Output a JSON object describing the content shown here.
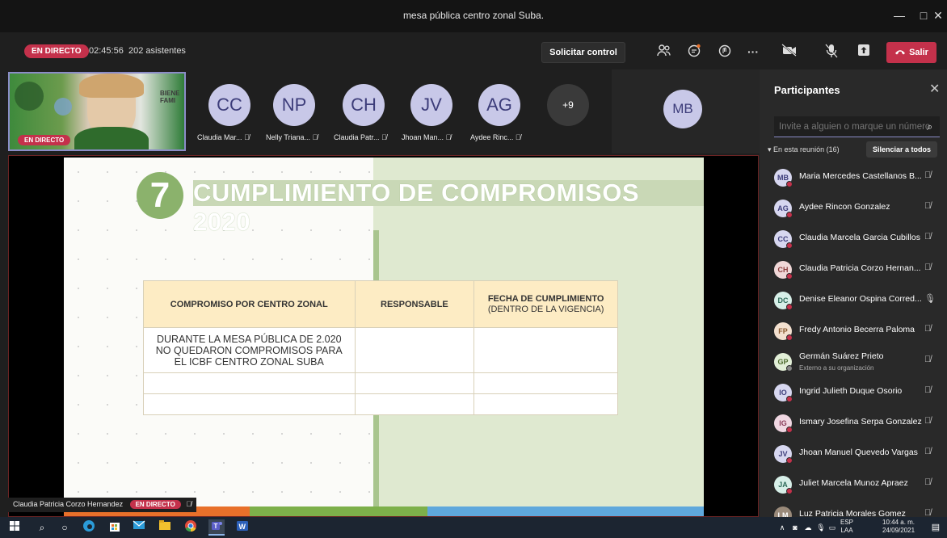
{
  "window": {
    "title": "mesa pública centro zonal Suba.",
    "minimize_label": "—",
    "maximize_label": "□",
    "close_label": "✕"
  },
  "meeting_bar": {
    "live_badge": "EN DIRECTO",
    "timer": "02:45:56",
    "attendees": "202 asistentes",
    "request_control_label": "Solicitar control",
    "more_label": "···",
    "leave_label": "Salir"
  },
  "video_strip": {
    "self_live_badge": "EN DIRECTO",
    "self_backdrop_text": "BIENE\nFAMI",
    "participants": [
      {
        "initials": "CC",
        "name": "Claudia Mar..."
      },
      {
        "initials": "NP",
        "name": "Nelly Triana..."
      },
      {
        "initials": "CH",
        "name": "Claudia Patr..."
      },
      {
        "initials": "JV",
        "name": "Jhoan Man..."
      },
      {
        "initials": "AG",
        "name": "Aydee Rinc..."
      }
    ],
    "overflow_count": "+9",
    "extra_participant_initials": "MB"
  },
  "slide": {
    "number": "7",
    "title": "CUMPLIMIENTO DE COMPROMISOS 2020",
    "table": {
      "headers": [
        "COMPROMISO POR CENTRO ZONAL",
        "RESPONSABLE",
        "FECHA DE CUMPLIMIENTO"
      ],
      "header_sub": "(DENTRO DE LA VIGENCIA)",
      "row1": "DURANTE LA MESA PÚBLICA DE 2.020 NO QUEDARON COMPROMISOS PARA EL ICBF CENTRO ZONAL SUBA"
    }
  },
  "presenter_plate": {
    "name": "Claudia Patricia Corzo Hernandez",
    "live_badge": "EN DIRECTO"
  },
  "participants_panel": {
    "title": "Participantes",
    "close_label": "✕",
    "invite_placeholder": "Invite a alguien o marque un número",
    "section_label": "En esta reunión (16)",
    "mute_all_label": "Silenciar a todos",
    "people": [
      {
        "initials": "MB",
        "name": "Maria Mercedes Castellanos B..."
      },
      {
        "initials": "AG",
        "name": "Aydee Rincon Gonzalez"
      },
      {
        "initials": "CC",
        "name": "Claudia Marcela Garcia Cubillos"
      },
      {
        "initials": "CH",
        "name": "Claudia Patricia Corzo Hernan..."
      },
      {
        "initials": "DC",
        "name": "Denise Eleanor Ospina Corred..."
      },
      {
        "initials": "FP",
        "name": "Fredy Antonio Becerra Paloma"
      },
      {
        "initials": "GP",
        "name": "Germán Suárez Prieto",
        "sub": "Externo a su organización"
      },
      {
        "initials": "IO",
        "name": "Ingrid Julieth Duque Osorio"
      },
      {
        "initials": "IG",
        "name": "Ismary Josefina Serpa Gonzalez"
      },
      {
        "initials": "JV",
        "name": "Jhoan Manuel Quevedo Vargas"
      },
      {
        "initials": "JA",
        "name": "Juliet Marcela Munoz Apraez"
      },
      {
        "initials": "LM",
        "name": "Luz Patricia Morales Gomez"
      }
    ]
  },
  "taskbar": {
    "lang_1": "ESP",
    "lang_2": "LAA",
    "time": "10:44 a. m.",
    "date": "24/09/2021"
  },
  "colors": {
    "live_red": "#c4314b",
    "accent_purple": "#8b8cc7",
    "slide_green": "#8bb26c",
    "table_header": "#fdecc4"
  }
}
